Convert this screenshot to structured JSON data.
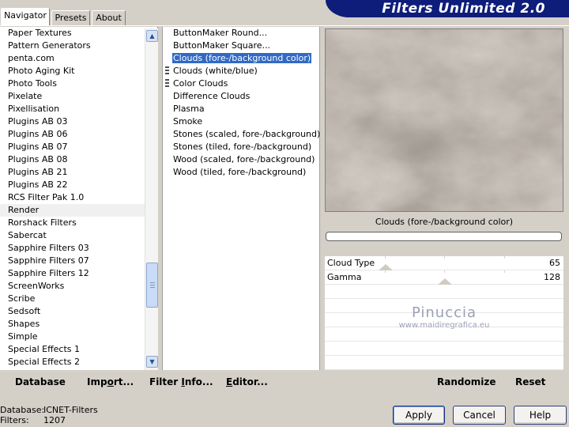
{
  "window": {
    "title": "Filters Unlimited 2.0"
  },
  "tabs": [
    {
      "label": "Navigator",
      "active": true
    },
    {
      "label": "Presets",
      "active": false
    },
    {
      "label": "About",
      "active": false
    }
  ],
  "categories": {
    "selected": "Render",
    "items": [
      "Paper Textures",
      "Pattern Generators",
      "penta.com",
      "Photo Aging Kit",
      "Photo Tools",
      "Pixelate",
      "Pixellisation",
      "Plugins AB 03",
      "Plugins AB 06",
      "Plugins AB 07",
      "Plugins AB 08",
      "Plugins AB 21",
      "Plugins AB 22",
      "RCS Filter Pak 1.0",
      "Render",
      "Rorshack Filters",
      "Sabercat",
      "Sapphire Filters 03",
      "Sapphire Filters 07",
      "Sapphire Filters 12",
      "ScreenWorks",
      "Scribe",
      "Sedsoft",
      "Shapes",
      "Simple",
      "Special Effects 1",
      "Special Effects 2"
    ]
  },
  "filters": {
    "selected": "Clouds (fore-/background color)",
    "items": [
      {
        "label": "ButtonMaker Round...",
        "favorite": false
      },
      {
        "label": "ButtonMaker Square...",
        "favorite": false
      },
      {
        "label": "Clouds (fore-/background color)",
        "favorite": false
      },
      {
        "label": "Clouds (white/blue)",
        "favorite": true
      },
      {
        "label": "Color Clouds",
        "favorite": true
      },
      {
        "label": "Difference Clouds",
        "favorite": false
      },
      {
        "label": "Plasma",
        "favorite": false
      },
      {
        "label": "Smoke",
        "favorite": false
      },
      {
        "label": "Stones (scaled, fore-/background)",
        "favorite": false
      },
      {
        "label": "Stones (tiled, fore-/background)",
        "favorite": false
      },
      {
        "label": "Wood (scaled, fore-/background)",
        "favorite": false
      },
      {
        "label": "Wood (tiled, fore-/background)",
        "favorite": false
      }
    ]
  },
  "preview": {
    "filter_name": "Clouds (fore-/background color)",
    "colors": {
      "dark": "#5e554c",
      "mid": "#8b8178",
      "light": "#e4ddd2"
    }
  },
  "parameters": [
    {
      "label": "Cloud Type",
      "value": "65",
      "level": 0.254
    },
    {
      "label": "Gamma",
      "value": "128",
      "level": 0.502
    }
  ],
  "watermark": {
    "name": "Pinuccia",
    "url": "www.maidiregrafica.eu"
  },
  "commands": {
    "database": "Database",
    "import_prefix": "Imp",
    "import_underlined": "o",
    "import_suffix": "rt...",
    "filter_info_prefix": "Filter ",
    "filter_info_underlined": "I",
    "filter_info_suffix": "nfo...",
    "editor_prefix": "",
    "editor_underlined": "E",
    "editor_suffix": "ditor...",
    "randomize": "Randomize",
    "reset": "Reset"
  },
  "status": {
    "database_key": "Database:",
    "database_value": "ICNET-Filters",
    "filters_key": "Filters:",
    "filters_value": "1207"
  },
  "buttons": {
    "apply": "Apply",
    "cancel": "Cancel",
    "help": "Help"
  },
  "accent": "#316ac5",
  "banner_color": "#0e1d7a"
}
